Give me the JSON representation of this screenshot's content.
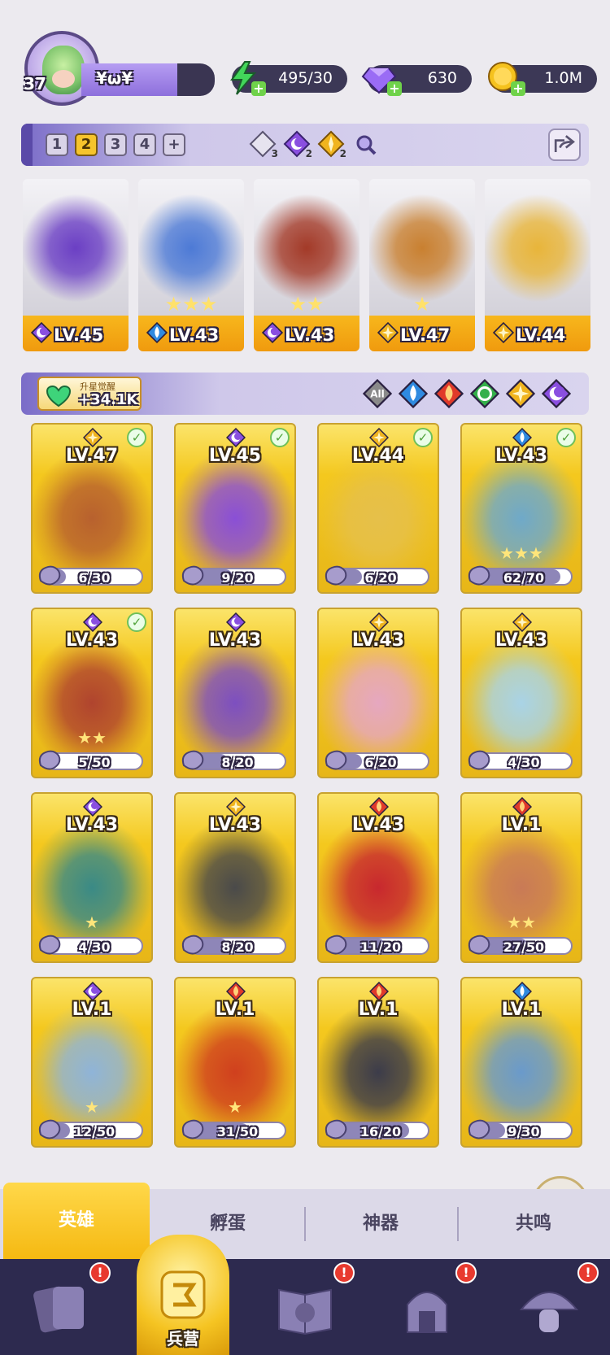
{
  "player": {
    "level": "37",
    "name": "¥ω¥"
  },
  "resources": [
    {
      "name": "energy",
      "icon": "lightning-icon",
      "value": "495/30",
      "color": "#42d65a"
    },
    {
      "name": "gems",
      "icon": "diamond-icon",
      "value": "630",
      "color": "#9a6cf5"
    },
    {
      "name": "gold",
      "icon": "coin-icon",
      "value": "1.0M",
      "color": "#f5c21e"
    }
  ],
  "team_tabs": [
    "1",
    "2",
    "3",
    "4",
    "+"
  ],
  "team_active": "2",
  "team_counts": [
    {
      "icon": "all-element-icon",
      "count": "3"
    },
    {
      "icon": "moon-element-icon",
      "count": "2"
    },
    {
      "icon": "light-element-icon",
      "count": "2"
    }
  ],
  "team": [
    {
      "element": "moon",
      "level": "LV.45",
      "stars": "",
      "art": "#6b3fc4"
    },
    {
      "element": "water",
      "level": "LV.43",
      "stars": "★★★",
      "art": "#4d7ad6"
    },
    {
      "element": "moon",
      "level": "LV.43",
      "stars": "★★",
      "art": "#a33a28"
    },
    {
      "element": "light",
      "level": "LV.47",
      "stars": "★",
      "art": "#c98030"
    },
    {
      "element": "light",
      "level": "LV.44",
      "stars": "",
      "art": "#e8b53a"
    }
  ],
  "awaken": {
    "label": "升星觉醒",
    "value": "+34.1K"
  },
  "filters": [
    {
      "name": "all",
      "label": "All",
      "color": "#8a8a8a"
    },
    {
      "name": "water",
      "label": "",
      "color": "#2f8ae0"
    },
    {
      "name": "fire",
      "label": "",
      "color": "#e03a2a"
    },
    {
      "name": "nature",
      "label": "",
      "color": "#34b04a"
    },
    {
      "name": "light",
      "label": "",
      "color": "#f0b41e"
    },
    {
      "name": "moon",
      "label": "",
      "color": "#8a4fe0"
    }
  ],
  "heroes": [
    {
      "level": "LV.47",
      "element": "light",
      "progress": "6/30",
      "ratio": 0.2,
      "check": true,
      "stars": "",
      "art": "#b8612e"
    },
    {
      "level": "LV.45",
      "element": "moon",
      "progress": "9/20",
      "ratio": 0.45,
      "check": true,
      "stars": "",
      "art": "#8a4fd6"
    },
    {
      "level": "LV.44",
      "element": "light",
      "progress": "6/20",
      "ratio": 0.3,
      "check": true,
      "stars": "",
      "art": "#e6c04a"
    },
    {
      "level": "LV.43",
      "element": "water",
      "progress": "62/70",
      "ratio": 0.89,
      "check": true,
      "stars": "★★★",
      "art": "#6fa9c9"
    },
    {
      "level": "LV.43",
      "element": "moon",
      "progress": "5/50",
      "ratio": 0.1,
      "check": true,
      "stars": "★★",
      "art": "#b0442e"
    },
    {
      "level": "LV.43",
      "element": "moon",
      "progress": "8/20",
      "ratio": 0.4,
      "check": false,
      "stars": "",
      "art": "#7d4fc0"
    },
    {
      "level": "LV.43",
      "element": "light",
      "progress": "6/20",
      "ratio": 0.3,
      "check": false,
      "stars": "",
      "art": "#e6a7c0"
    },
    {
      "level": "LV.43",
      "element": "light",
      "progress": "4/30",
      "ratio": 0.13,
      "check": false,
      "stars": "",
      "art": "#a9d3e6"
    },
    {
      "level": "LV.43",
      "element": "moon",
      "progress": "4/30",
      "ratio": 0.13,
      "check": false,
      "stars": "★",
      "art": "#3a8a86"
    },
    {
      "level": "LV.43",
      "element": "light",
      "progress": "8/20",
      "ratio": 0.4,
      "check": false,
      "stars": "",
      "art": "#4a4a4a"
    },
    {
      "level": "LV.43",
      "element": "fire",
      "progress": "11/20",
      "ratio": 0.55,
      "check": false,
      "stars": "",
      "art": "#c8282e"
    },
    {
      "level": "LV.1",
      "element": "fire",
      "progress": "27/50",
      "ratio": 0.54,
      "check": false,
      "stars": "★★",
      "art": "#c97a56"
    },
    {
      "level": "LV.1",
      "element": "moon",
      "progress": "12/50",
      "ratio": 0.24,
      "check": false,
      "stars": "★",
      "art": "#8fb4d8"
    },
    {
      "level": "LV.1",
      "element": "fire",
      "progress": "31/50",
      "ratio": 0.62,
      "check": false,
      "stars": "★",
      "art": "#d0401e"
    },
    {
      "level": "LV.1",
      "element": "fire",
      "progress": "16/20",
      "ratio": 0.8,
      "check": false,
      "stars": "",
      "art": "#3c3c4a"
    },
    {
      "level": "LV.1",
      "element": "water",
      "progress": "9/30",
      "ratio": 0.3,
      "check": false,
      "stars": "",
      "art": "#6a9acb"
    }
  ],
  "sub_tabs": [
    "英雄",
    "孵蛋",
    "神器",
    "共鸣"
  ],
  "nav": [
    {
      "name": "cards",
      "icon": "cards-icon",
      "label": "",
      "alert": "!"
    },
    {
      "name": "barracks",
      "icon": "barracks-icon",
      "label": "兵营",
      "alert": ""
    },
    {
      "name": "map",
      "icon": "book-icon",
      "label": "",
      "alert": "!"
    },
    {
      "name": "temple",
      "icon": "temple-icon",
      "label": "",
      "alert": "!"
    },
    {
      "name": "mushroom",
      "icon": "mushroom-icon",
      "label": "",
      "alert": "!"
    }
  ]
}
